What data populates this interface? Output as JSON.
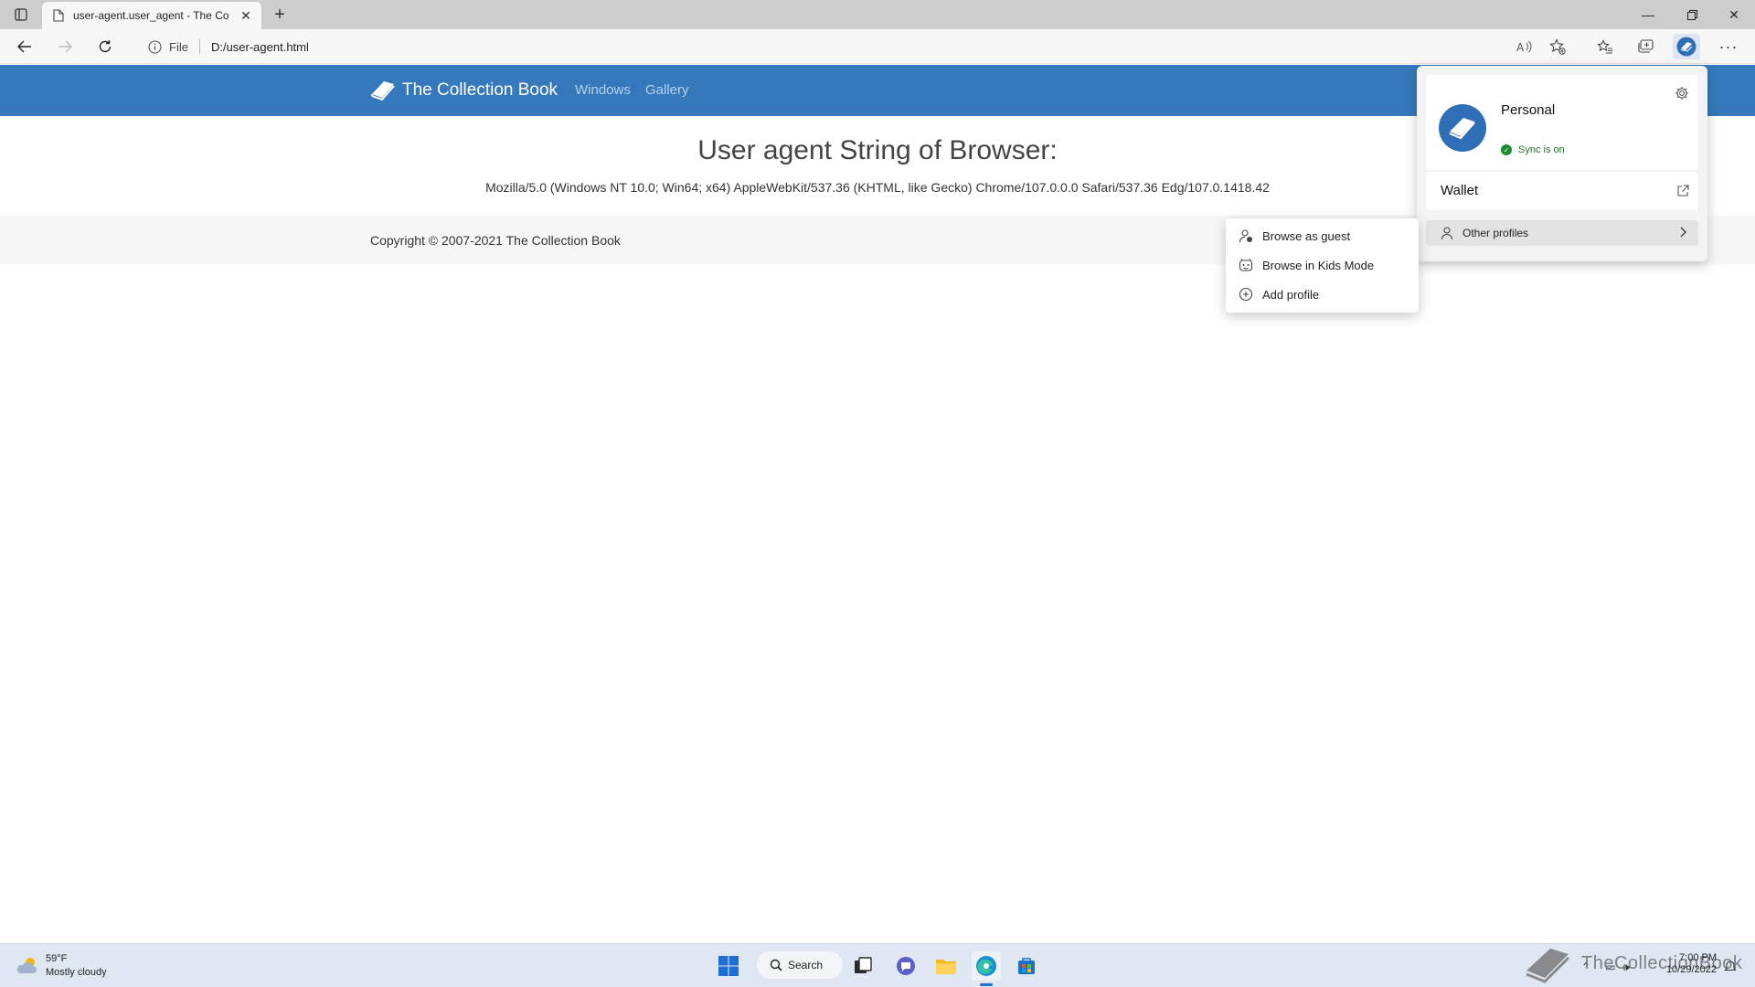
{
  "browser": {
    "tab_title": "user-agent.user_agent - The Coll",
    "address_scheme": "File",
    "address_url": "D:/user-agent.html"
  },
  "page": {
    "brand": "The Collection Book",
    "nav_links": [
      "Windows",
      "Gallery"
    ],
    "title": "User agent String of Browser:",
    "user_agent": "Mozilla/5.0 (Windows NT 10.0; Win64; x64) AppleWebKit/537.36 (KHTML, like Gecko) Chrome/107.0.0.0 Safari/537.36 Edg/107.0.1418.42",
    "copyright": "Copyright © 2007-2021 The Collection Book"
  },
  "profile_panel": {
    "name": "Personal",
    "sync_status": "Sync is on",
    "wallet_label": "Wallet",
    "other_profiles_label": "Other profiles"
  },
  "submenu": {
    "items": [
      "Browse as guest",
      "Browse in Kids Mode",
      "Add profile"
    ]
  },
  "taskbar": {
    "temperature": "59°F",
    "weather_desc": "Mostly cloudy",
    "search_label": "Search",
    "time": "7:00 PM",
    "date": "10/29/2022",
    "watermark": "TheCollectionBook"
  },
  "colors": {
    "site_nav_bg": "#3579bc",
    "accent": "#1d6fd1",
    "sync_green": "#1a8a2e"
  }
}
